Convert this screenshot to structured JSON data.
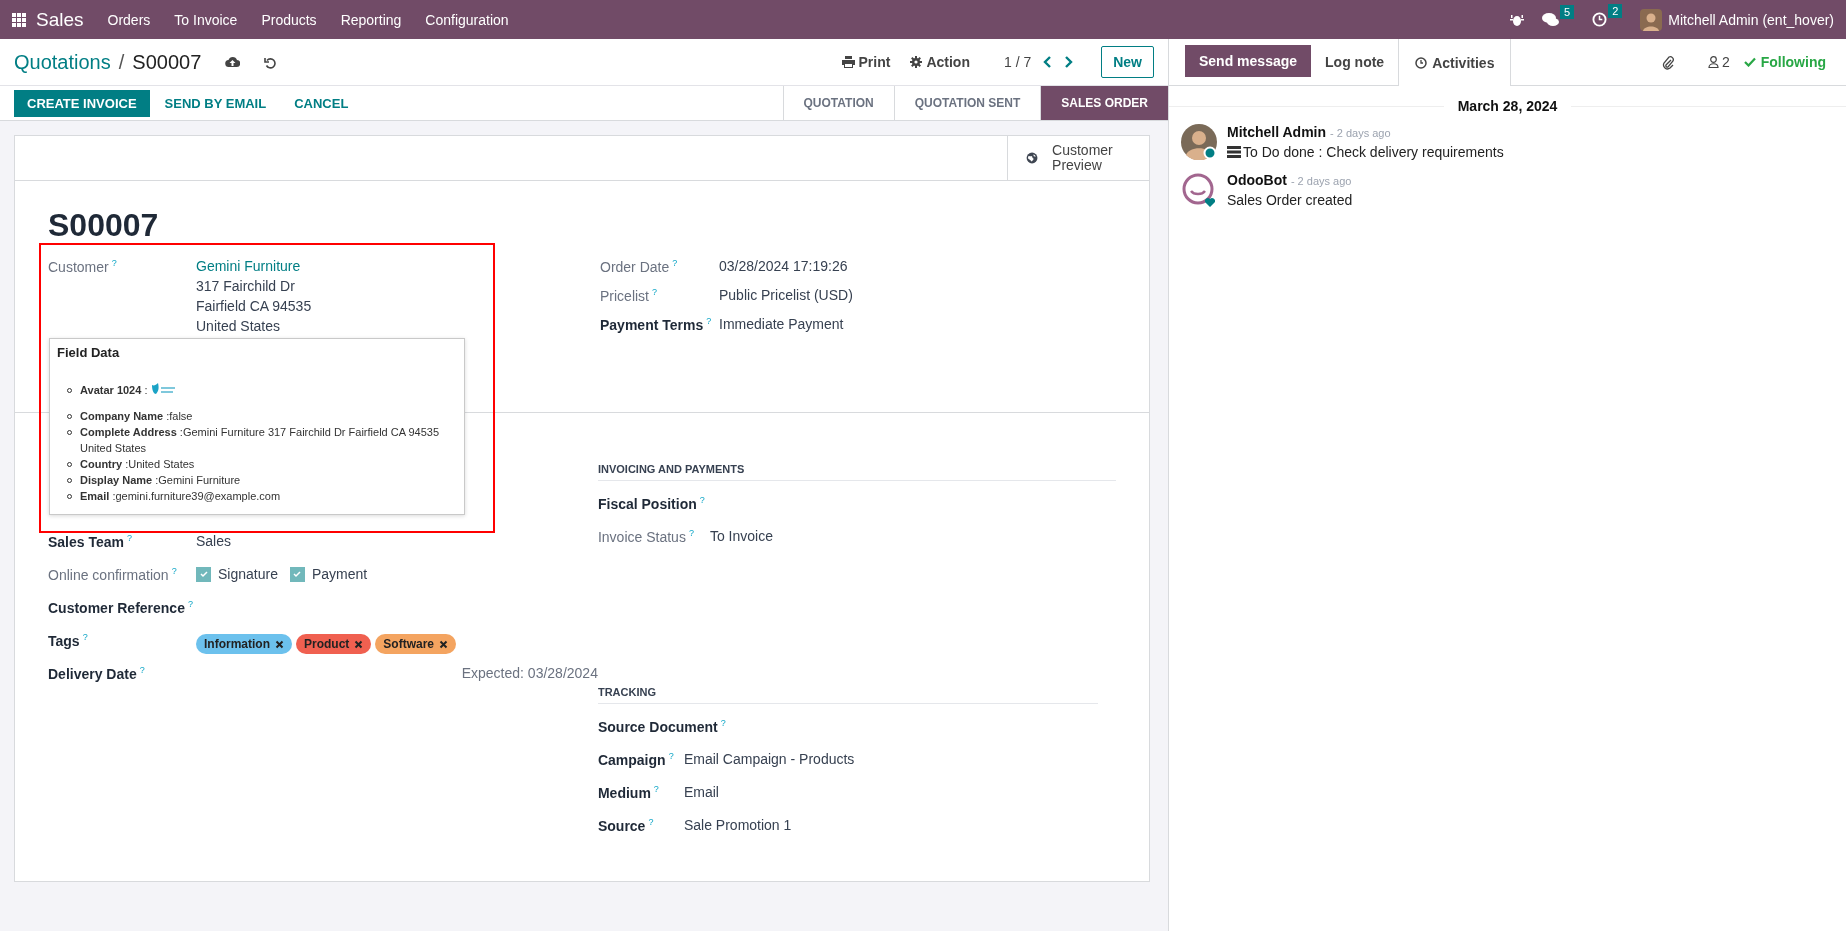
{
  "navbar": {
    "app": "Sales",
    "menu": [
      "Orders",
      "To Invoice",
      "Products",
      "Reporting",
      "Configuration"
    ],
    "messages_count": "5",
    "activities_count": "2",
    "user": "Mitchell Admin (ent_hover)"
  },
  "breadcrumb": {
    "parent": "Quotations",
    "separator": "/",
    "current": "S00007"
  },
  "actions": {
    "print": "Print",
    "action": "Action",
    "pager": "1 / 7",
    "new": "New"
  },
  "buttons": [
    {
      "label": "CREATE INVOICE",
      "primary": true
    },
    {
      "label": "SEND BY EMAIL",
      "primary": false
    },
    {
      "label": "CANCEL",
      "primary": false
    }
  ],
  "stages": [
    {
      "label": "QUOTATION",
      "selected": false
    },
    {
      "label": "QUOTATION SENT",
      "selected": false
    },
    {
      "label": "SALES ORDER",
      "selected": true
    }
  ],
  "smart_button": {
    "label": "Customer Preview"
  },
  "title": "S00007",
  "customer": {
    "label": "Customer",
    "help": "?",
    "name": "Gemini Furniture",
    "address": [
      "317 Fairchild Dr",
      "Fairfield CA 94535",
      "United States"
    ]
  },
  "info_fields": [
    {
      "label": "Order Date",
      "help": "?",
      "bold": false,
      "value": "03/28/2024 17:19:26"
    },
    {
      "label": "Pricelist",
      "help": "?",
      "bold": false,
      "value": "Public Pricelist (USD)"
    },
    {
      "label": "Payment Terms",
      "help": "?",
      "bold": true,
      "value": "Immediate Payment"
    }
  ],
  "popover": {
    "title": "Field Data",
    "items": [
      {
        "kind": "image",
        "key": "Avatar 1024",
        "value": ":"
      },
      {
        "kind": "text",
        "key": "Company Name",
        "value": ":false"
      },
      {
        "kind": "text",
        "key": "Complete Address",
        "value": ":Gemini Furniture 317 Fairchild Dr Fairfield CA 94535 United States"
      },
      {
        "kind": "text",
        "key": "Country",
        "value": ":United States"
      },
      {
        "kind": "text",
        "key": "Display Name",
        "value": ":Gemini Furniture"
      },
      {
        "kind": "text",
        "key": "Email",
        "value": ":gemini.furniture39@example.com"
      }
    ]
  },
  "left_fields": [
    {
      "kind": "text",
      "label": "Sales Team",
      "help": "?",
      "bold": true,
      "value": "Sales"
    },
    {
      "kind": "checkboxes",
      "label": "Online confirmation",
      "help": "?",
      "bold": false,
      "options": [
        {
          "label": "Signature",
          "checked": true
        },
        {
          "label": "Payment",
          "checked": true
        }
      ]
    },
    {
      "kind": "text",
      "label": "Customer Reference",
      "help": "?",
      "bold": true
    },
    {
      "kind": "tags",
      "label": "Tags",
      "help": "?",
      "bold": true,
      "tags": [
        {
          "label": "Information",
          "color": "#6cc1ed"
        },
        {
          "label": "Product",
          "color": "#f06050"
        },
        {
          "label": "Software",
          "color": "#f4a460"
        }
      ]
    },
    {
      "kind": "hint",
      "label": "Delivery Date",
      "help": "?",
      "bold": true,
      "value": "Expected: 03/28/2024"
    }
  ],
  "invoicing": {
    "title": "INVOICING AND PAYMENTS",
    "fields": [
      {
        "label": "Fiscal Position",
        "help": "?",
        "bold": true
      },
      {
        "label": "Invoice Status",
        "help": "?",
        "bold": false,
        "value": "To Invoice"
      }
    ]
  },
  "tracking": {
    "title": "TRACKING",
    "fields": [
      {
        "label": "Source Document",
        "help": "?",
        "bold": true
      },
      {
        "label": "Campaign",
        "help": "?",
        "bold": true,
        "value": "Email Campaign - Products"
      },
      {
        "label": "Medium",
        "help": "?",
        "bold": true,
        "value": "Email"
      },
      {
        "label": "Source",
        "help": "?",
        "bold": true,
        "value": "Sale Promotion 1"
      }
    ]
  },
  "chatter": {
    "tabs": [
      {
        "kind": "primary",
        "label": "Send message"
      },
      {
        "kind": "plain",
        "label": "Log note"
      },
      {
        "kind": "activity",
        "label": "Activities"
      }
    ],
    "followers": "2",
    "following": "Following",
    "date": "March 28, 2024",
    "messages": [
      {
        "kind": "activity",
        "author": "Mitchell Admin",
        "time": "- 2 days ago",
        "body": "To Do done : Check delivery requirements"
      },
      {
        "kind": "bot",
        "author": "OdooBot",
        "time": "- 2 days ago",
        "body": "Sales Order created"
      }
    ]
  }
}
